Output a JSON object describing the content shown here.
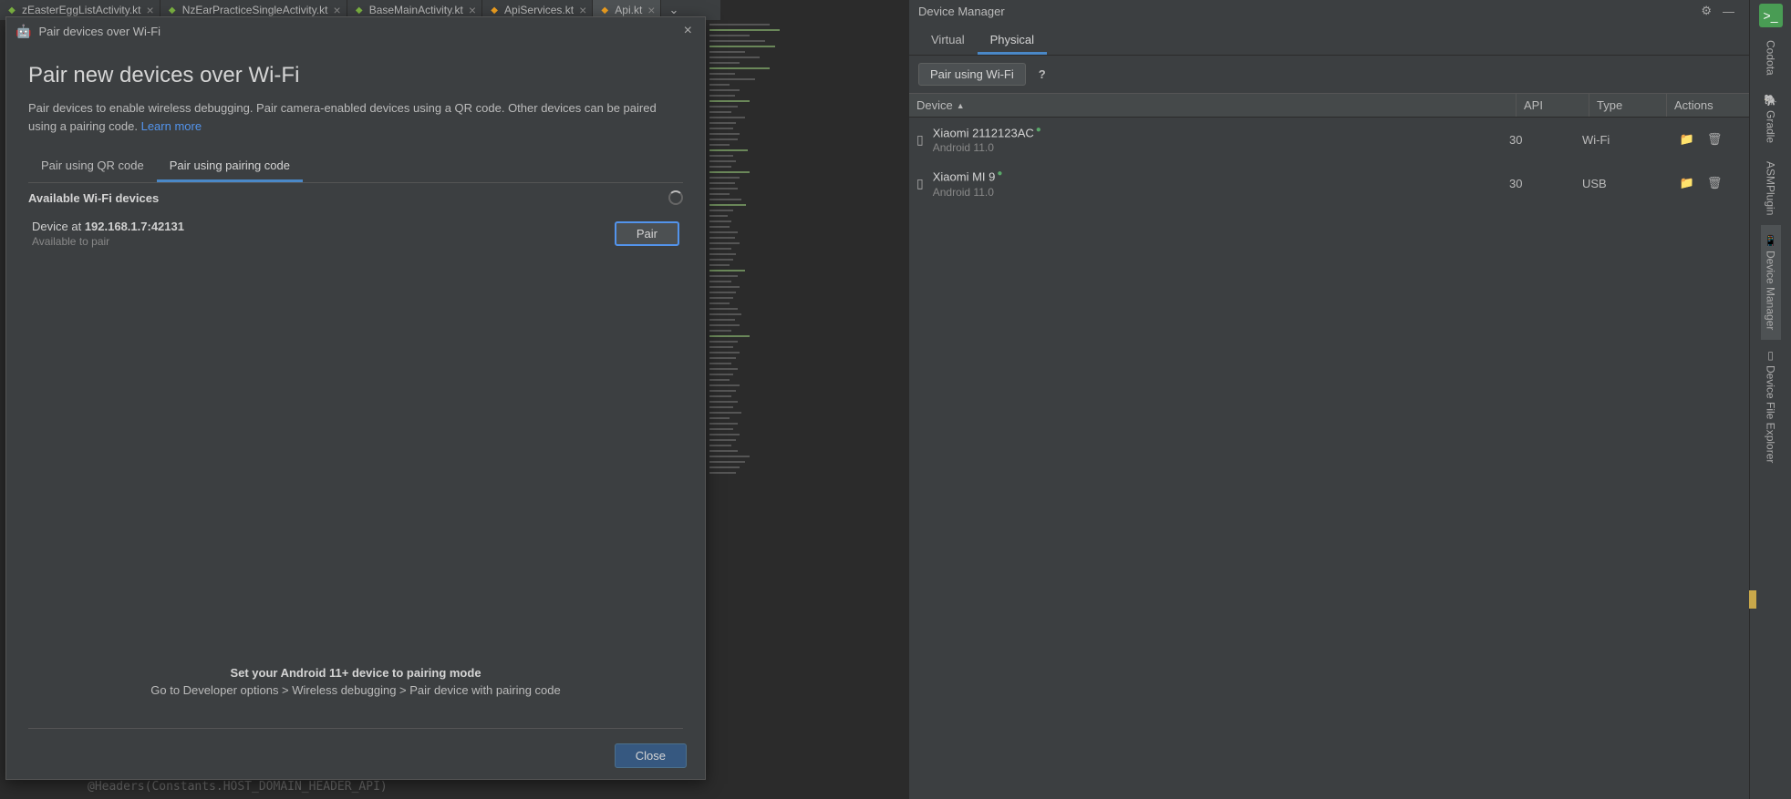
{
  "tabs": {
    "t0": "zEasterEggListActivity.kt",
    "t1": "NzEarPracticeSingleActivity.kt",
    "t2": "BaseMainActivity.kt",
    "t3": "ApiServices.kt",
    "t4": "Api.kt"
  },
  "dialog": {
    "window_title": "Pair devices over Wi-Fi",
    "heading": "Pair new devices over Wi-Fi",
    "desc_a": "Pair devices to enable wireless debugging. Pair camera-enabled devices using a QR code. Other devices can be paired using a pairing code. ",
    "learn_more": "Learn more",
    "tab_qr": "Pair using QR code",
    "tab_code": "Pair using pairing code",
    "available_header": "Available Wi-Fi devices",
    "device_prefix": "Device at ",
    "device_addr": "192.168.1.7:42131",
    "device_sub": "Available to pair",
    "pair_btn": "Pair",
    "hint_bold": "Set your Android 11+ device to pairing mode",
    "hint_line": "Go to Developer options > Wireless debugging > Pair device with pairing code",
    "close_btn": "Close"
  },
  "dm": {
    "title": "Device Manager",
    "tab_virtual": "Virtual",
    "tab_physical": "Physical",
    "wifi_btn": "Pair using Wi-Fi",
    "help": "?",
    "th_device": "Device",
    "th_api": "API",
    "th_type": "Type",
    "th_actions": "Actions",
    "row0": {
      "name": "Xiaomi 2112123AC",
      "sub": "Android 11.0",
      "api": "30",
      "type": "Wi-Fi"
    },
    "row1": {
      "name": "Xiaomi MI 9",
      "sub": "Android 11.0",
      "api": "30",
      "type": "USB"
    }
  },
  "rs": {
    "codota": "Codota",
    "gradle": "Gradle",
    "asm": "ASMPlugin",
    "dm": "Device Manager",
    "dfe": "Device File Explorer"
  },
  "code_frag": "@Headers(Constants.HOST_DOMAIN_HEADER_API)"
}
